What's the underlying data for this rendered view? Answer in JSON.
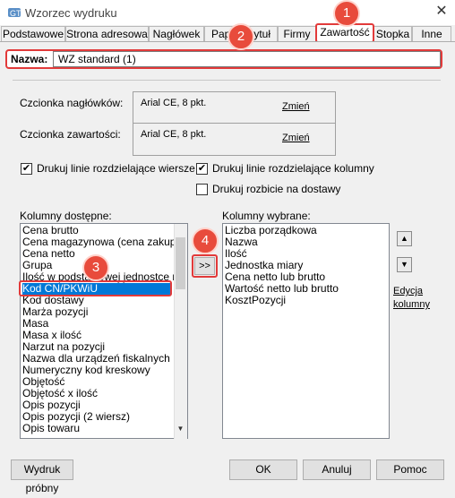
{
  "window": {
    "title": "Wzorzec wydruku",
    "close_glyph": "✕"
  },
  "tabs": [
    {
      "label": "Podstawowe"
    },
    {
      "label": "Strona adresowa"
    },
    {
      "label": "Nagłówek"
    },
    {
      "label": "Papier i tytuł"
    },
    {
      "label": "Firmy"
    },
    {
      "label": "Zawartość"
    },
    {
      "label": "Stopka"
    },
    {
      "label": "Inne"
    }
  ],
  "active_tab": "Zawartość",
  "name": {
    "label": "Nazwa:",
    "value": "WZ standard (1)"
  },
  "fonts": {
    "header_label": "Czcionka nagłówków:",
    "header_value": "Arial CE, 8 pkt.",
    "content_label": "Czcionka zawartości:",
    "content_value": "Arial CE, 8 pkt.",
    "change_label": "Zmień"
  },
  "options": {
    "row_lines": {
      "label": "Drukuj linie rozdzielające wiersze",
      "checked": true
    },
    "col_lines": {
      "label": "Drukuj linie rozdzielające kolumny",
      "checked": true
    },
    "deliveries": {
      "label": "Drukuj rozbicie na dostawy",
      "checked": false
    }
  },
  "available": {
    "label": "Kolumny dostępne:",
    "items": [
      "Cena brutto",
      "Cena magazynowa (cena zakupu)",
      "Cena netto",
      "Grupa",
      "Ilość w podstawowej jednostce mi",
      "Kod CN/PKWiU",
      "Kod dostawy",
      "Marża pozycji",
      "Masa",
      "Masa x ilość",
      "Narzut na pozycji",
      "Nazwa dla urządzeń fiskalnych",
      "Numeryczny kod kreskowy",
      "Objętość",
      "Objętość x ilość",
      "Opis pozycji",
      "Opis pozycji (2 wiersz)",
      "Opis towaru"
    ],
    "selected": "Kod CN/PKWiU"
  },
  "chosen": {
    "label": "Kolumny wybrane:",
    "items": [
      "Liczba porządkowa",
      "Nazwa",
      "Ilość",
      "Jednostka miary",
      "Cena netto lub brutto",
      "Wartość netto lub brutto",
      "KosztPozycji"
    ]
  },
  "move_button": ">>",
  "edit_columns": {
    "line1": "Edycja",
    "line2": "kolumny"
  },
  "buttons": {
    "preview": "Wydruk próbny",
    "ok": "OK",
    "cancel": "Anuluj",
    "help": "Pomoc"
  },
  "badges": [
    "1",
    "2",
    "3",
    "4"
  ],
  "colors": {
    "highlight": "#e23a3a",
    "selection": "#0078d7"
  }
}
